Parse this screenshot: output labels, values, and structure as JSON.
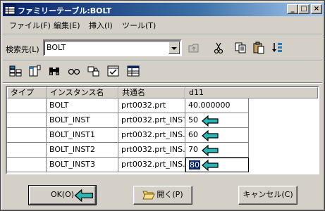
{
  "window": {
    "title": "ファミリーテーブル:BOLT"
  },
  "titlebar_buttons": {
    "minimize": "_",
    "maximize": "□",
    "close": "×"
  },
  "menu": [
    "ファイル(F)",
    "編集(E)",
    "挿入(I)",
    "ツール(T)"
  ],
  "search": {
    "label": "検索先(L)",
    "value": "BOLT"
  },
  "toolbar_top_icons": [
    "folder-up-icon",
    "scissors-icon",
    "copy-icon",
    "paste-icon",
    "sort-icon"
  ],
  "toolbar_icons": [
    "add-column-icon",
    "insert-column-icon",
    "find-binoculars-icon",
    "verify-glasses-icon",
    "lock-instance-icon",
    "checkbox-table-icon",
    "table-icon"
  ],
  "table": {
    "headers": [
      "タイプ",
      "インスタンス名",
      "共通名",
      "d11"
    ],
    "rows": [
      {
        "type": "",
        "instance": "BOLT",
        "common": "prt0032.prt",
        "d11": "40.000000"
      },
      {
        "type": "",
        "instance": "BOLT_INST",
        "common": "prt0032.prt_INST",
        "d11": "50"
      },
      {
        "type": "",
        "instance": "BOLT_INST1",
        "common": "prt0032.prt_INS...",
        "d11": "60"
      },
      {
        "type": "",
        "instance": "BOLT_INST2",
        "common": "prt0032.prt_INS...",
        "d11": "70"
      },
      {
        "type": "",
        "instance": "BOLT_INST3",
        "common": "prt0032.prt_INS...",
        "d11": "80"
      }
    ]
  },
  "buttons": {
    "ok": "OK(O)",
    "open": "開く(P)",
    "cancel": "キャンセル(C)"
  },
  "colors": {
    "titlebar_start": "#0a246a",
    "titlebar_end": "#a6caf0",
    "arrow_fill": "#2ab5b5"
  }
}
